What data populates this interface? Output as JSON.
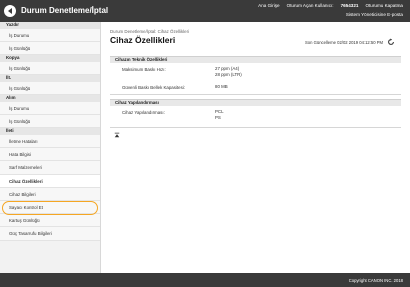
{
  "header": {
    "brand": "Durum Denetleme/İptal",
    "login_label": "Ana Girişe",
    "logout_label": "Oturum Açan Kullanıcı:",
    "user_id": "7654321",
    "signout_label": "Oturumu Kapatma",
    "system_link": "Sistem Yöneticisine E-posta"
  },
  "sidebar": {
    "categories": [
      {
        "label": "Yazdır",
        "items": [
          "İş Durumu",
          "İş Günlüğü"
        ]
      },
      {
        "label": "Kopya",
        "items": [
          "İş Günlüğü"
        ]
      },
      {
        "label": "İlt.",
        "items": [
          "İş Günlüğü"
        ]
      },
      {
        "label": "Alım",
        "items": [
          "İş Durumu",
          "İş Günlüğü"
        ]
      },
      {
        "label": "İleti",
        "items": [
          "İletme Hataları",
          "Hata Bilgisi",
          "Sarf Malzemeleri",
          "Cihaz Özellikleri",
          "Cihaz Bilgileri",
          "Sayacı Kontrol Et",
          "Kartuş Günlüğü",
          "Güç Tasarrufu Bilgileri"
        ]
      }
    ]
  },
  "main": {
    "breadcrumb": "Durum Denetleme/İptal: Cihaz Özellikleri",
    "title": "Cihaz Özellikleri",
    "last_updated": "Son Güncelleme 02/02 2019 04:12:50 PM",
    "spec_section": "Cihazın Teknik Özellikleri",
    "max_speed_label": "Maksimum Baskı Hızı:",
    "max_speed_a4": "27 ppm (A4)",
    "max_speed_ltr": "28 ppm (LTR)",
    "secure_mem_label": "Güvenli Baskı Bellek Kapasitesi:",
    "secure_mem_value": "80 MB",
    "config_section": "Cihaz Yapılandırması",
    "config_label": "Cihaz Yapılandırması:",
    "config_value_1": "PCL",
    "config_value_2": "PS"
  },
  "footer": {
    "copyright": "Copyright CANON INC. 2018"
  },
  "icons": {
    "logo": "canon-logo-icon",
    "refresh": "refresh-icon",
    "to_top": "to-top-icon"
  }
}
